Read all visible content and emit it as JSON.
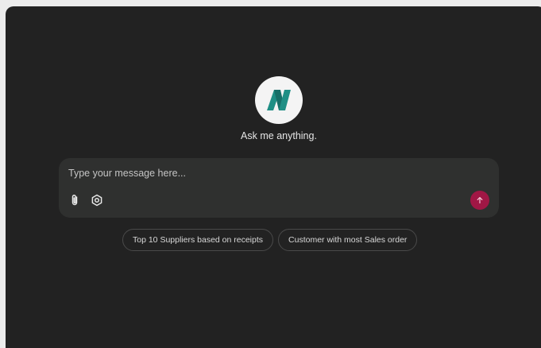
{
  "assistant": {
    "logo_icon": "brand-logo-icon",
    "tagline": "Ask me anything."
  },
  "composer": {
    "placeholder": "Type your message here...",
    "attach_icon": "paperclip-icon",
    "settings_icon": "gear-icon",
    "send_icon": "arrow-up-icon",
    "send_color": "#a01745"
  },
  "suggestions": [
    {
      "label": "Top 10 Suppliers based on receipts"
    },
    {
      "label": "Customer with most Sales order"
    }
  ],
  "colors": {
    "panel_bg": "#222222",
    "composer_bg": "#2f302f",
    "logo_teal": "#1f8f85"
  }
}
